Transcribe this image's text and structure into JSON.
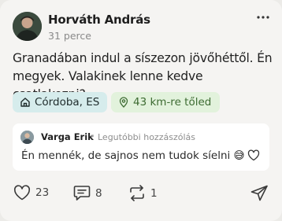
{
  "post": {
    "author": "Horváth András",
    "time": "31 perce",
    "text": "Granadában indul a síszezon jövőhéttől. Én megyek. Valakinek lenne kedve csatlakozni?",
    "location_chip": "Córdoba, ES",
    "distance_chip": "43 km-re tőled"
  },
  "comment": {
    "author": "Varga Erik",
    "separator": "•",
    "tag": "Legutóbbi hozzászólás",
    "text": "Én mennék, de sajnos nem tudok síelni 😅"
  },
  "actions": {
    "likes": "23",
    "comments": "8",
    "reposts": "1"
  },
  "icons": [
    "more-icon",
    "home-icon",
    "location-pin-icon",
    "heart-icon",
    "comment-icon",
    "repost-icon",
    "send-icon"
  ],
  "colors": {
    "location_chip_bg": "#d6ecec",
    "distance_chip_bg": "#e2f2dc",
    "distance_chip_text": "#3d6b32"
  }
}
